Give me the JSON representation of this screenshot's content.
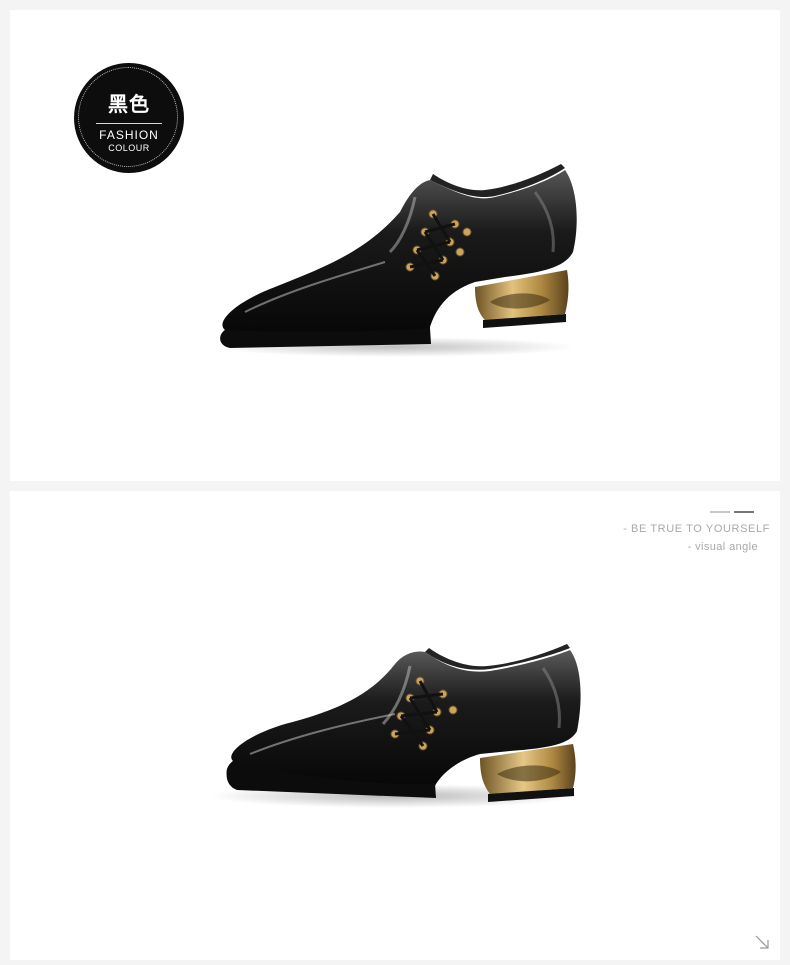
{
  "badge": {
    "chinese_label": "黑色",
    "line1": "FASHION",
    "line2": "COLOUR"
  },
  "section2": {
    "tagline": "- BE TRUE TO YOURSELF",
    "subtitle": "- visual angle"
  },
  "images": {
    "top": "black-patent-shoe-image",
    "bottom": "black-patent-shoe-image"
  },
  "icons": {
    "corner": "arrow-down-right-icon"
  },
  "colors": {
    "page_background": "#f4f4f4",
    "panel_background": "#ffffff",
    "badge_background": "#0d0d0d",
    "shoe_black": "#0a0a0a",
    "heel_gold": "#c9a55e",
    "text_muted": "#a8a8a8"
  }
}
